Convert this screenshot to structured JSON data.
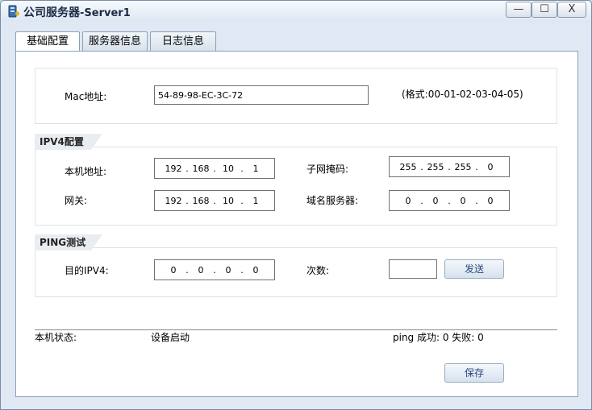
{
  "window": {
    "title_main": "公司服务器",
    "title_suffix": "-Server1",
    "min_symbol": "—",
    "max_symbol": "☐",
    "close_symbol": "X",
    "icon": "server-icon"
  },
  "tabs": [
    {
      "label": "基础配置",
      "active": true
    },
    {
      "label": "服务器信息",
      "active": false
    },
    {
      "label": "日志信息",
      "active": false
    }
  ],
  "mac": {
    "label": "Mac地址:",
    "value": "54-89-98-EC-3C-72",
    "format_hint": "(格式:00-01-02-03-04-05)"
  },
  "ipv4": {
    "group_title": "IPV4配置",
    "local_label": "本机地址:",
    "local": [
      "192",
      "168",
      "10",
      "1"
    ],
    "mask_label": "子网掩码:",
    "mask": [
      "255",
      "255",
      "255",
      "0"
    ],
    "gateway_label": "网关:",
    "gateway": [
      "192",
      "168",
      "10",
      "1"
    ],
    "dns_label": "域名服务器:",
    "dns": [
      "0",
      "0",
      "0",
      "0"
    ]
  },
  "ping": {
    "group_title": "PING测试",
    "target_label": "目的IPV4:",
    "target": [
      "0",
      "0",
      "0",
      "0"
    ],
    "count_label": "次数:",
    "count_value": "",
    "send_label": "发送"
  },
  "status": {
    "label": "本机状态:",
    "value": "设备启动",
    "ping_result": "ping 成功: 0 失败: 0"
  },
  "save_label": "保存",
  "colors": {
    "button_text": "#2a4a80",
    "title_text": "#1a2a44"
  }
}
